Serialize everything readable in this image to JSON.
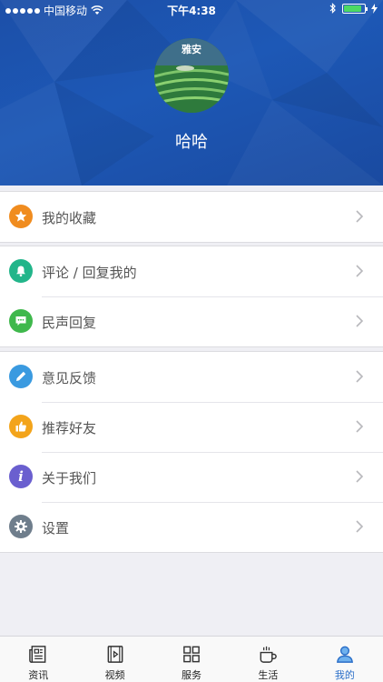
{
  "status_bar": {
    "carrier": "中国移动",
    "time": "下午4:38",
    "battery_level": 0.85
  },
  "profile": {
    "avatar_caption": "雅安",
    "username": "哈哈"
  },
  "menu_groups": [
    {
      "items": [
        {
          "label": "我的收藏",
          "icon": "star-icon",
          "color": "#f08c1f"
        }
      ]
    },
    {
      "items": [
        {
          "label": "评论 / 回复我的",
          "icon": "bell-icon",
          "color": "#22b58a"
        },
        {
          "label": "民声回复",
          "icon": "chat-icon",
          "color": "#3fb84c"
        }
      ]
    },
    {
      "items": [
        {
          "label": "意见反馈",
          "icon": "pencil-icon",
          "color": "#3a9ae0"
        },
        {
          "label": "推荐好友",
          "icon": "thumbs-up-icon",
          "color": "#f3a41b"
        },
        {
          "label": "关于我们",
          "icon": "info-icon",
          "color": "#6a5fcf"
        },
        {
          "label": "设置",
          "icon": "gear-icon",
          "color": "#6f7e8c"
        }
      ]
    }
  ],
  "tab_bar": {
    "tabs": [
      {
        "label": "资讯",
        "icon": "news-icon"
      },
      {
        "label": "视频",
        "icon": "video-icon"
      },
      {
        "label": "服务",
        "icon": "grid-icon"
      },
      {
        "label": "生活",
        "icon": "coffee-icon"
      },
      {
        "label": "我的",
        "icon": "person-icon",
        "active": true
      }
    ],
    "active_color": "#2a6ec8"
  }
}
